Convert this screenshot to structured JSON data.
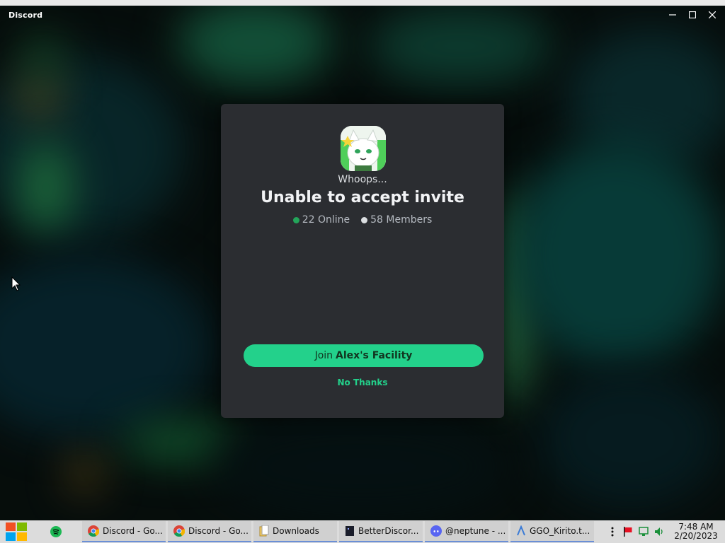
{
  "window": {
    "title": "Discord"
  },
  "modal": {
    "subtitle": "Whoops...",
    "title": "Unable to accept invite",
    "online_count": "22 Online",
    "member_count": "58 Members",
    "join_prefix": "Join",
    "join_server": "Alex's Facility",
    "dismiss_label": "No Thanks"
  },
  "colors": {
    "accent": "#23d18b",
    "online": "#23a55a",
    "members": "#dbdee1",
    "modal_bg": "#2b2d31"
  },
  "taskbar": {
    "tasks": [
      {
        "icon": "chrome-icon",
        "label": "Discord - Go..."
      },
      {
        "icon": "chrome-icon",
        "label": "Discord - Go..."
      },
      {
        "icon": "folder-icon",
        "label": "Downloads"
      },
      {
        "icon": "terminal-icon",
        "label": "BetterDiscor..."
      },
      {
        "icon": "discord-icon",
        "label": "@neptune - ..."
      },
      {
        "icon": "file-icon",
        "label": "GGO_Kirito.t..."
      }
    ],
    "clock_time": "7:48 AM",
    "clock_date": "2/20/2023"
  }
}
